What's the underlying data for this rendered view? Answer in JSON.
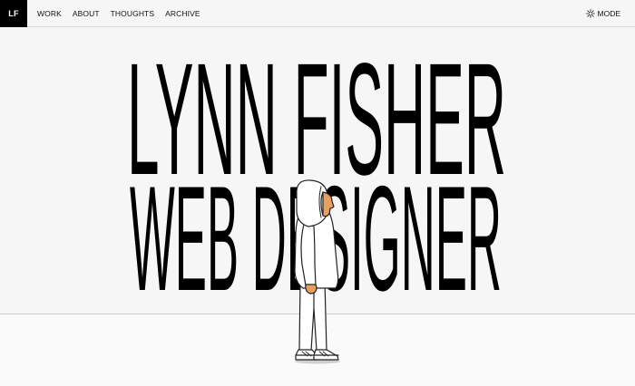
{
  "header": {
    "logo": "LF",
    "nav": [
      "WORK",
      "ABOUT",
      "THOUGHTS",
      "ARCHIVE"
    ],
    "mode_label": "MODE",
    "mode_icon": "sun-icon"
  },
  "hero": {
    "line1": "LYNN FISHER",
    "line2": "WEB DESIGNER"
  },
  "colors": {
    "background": "#f6f6f6",
    "text": "#000000",
    "logo_bg": "#000000",
    "logo_fg": "#ffffff",
    "skin": "#e8a060"
  }
}
